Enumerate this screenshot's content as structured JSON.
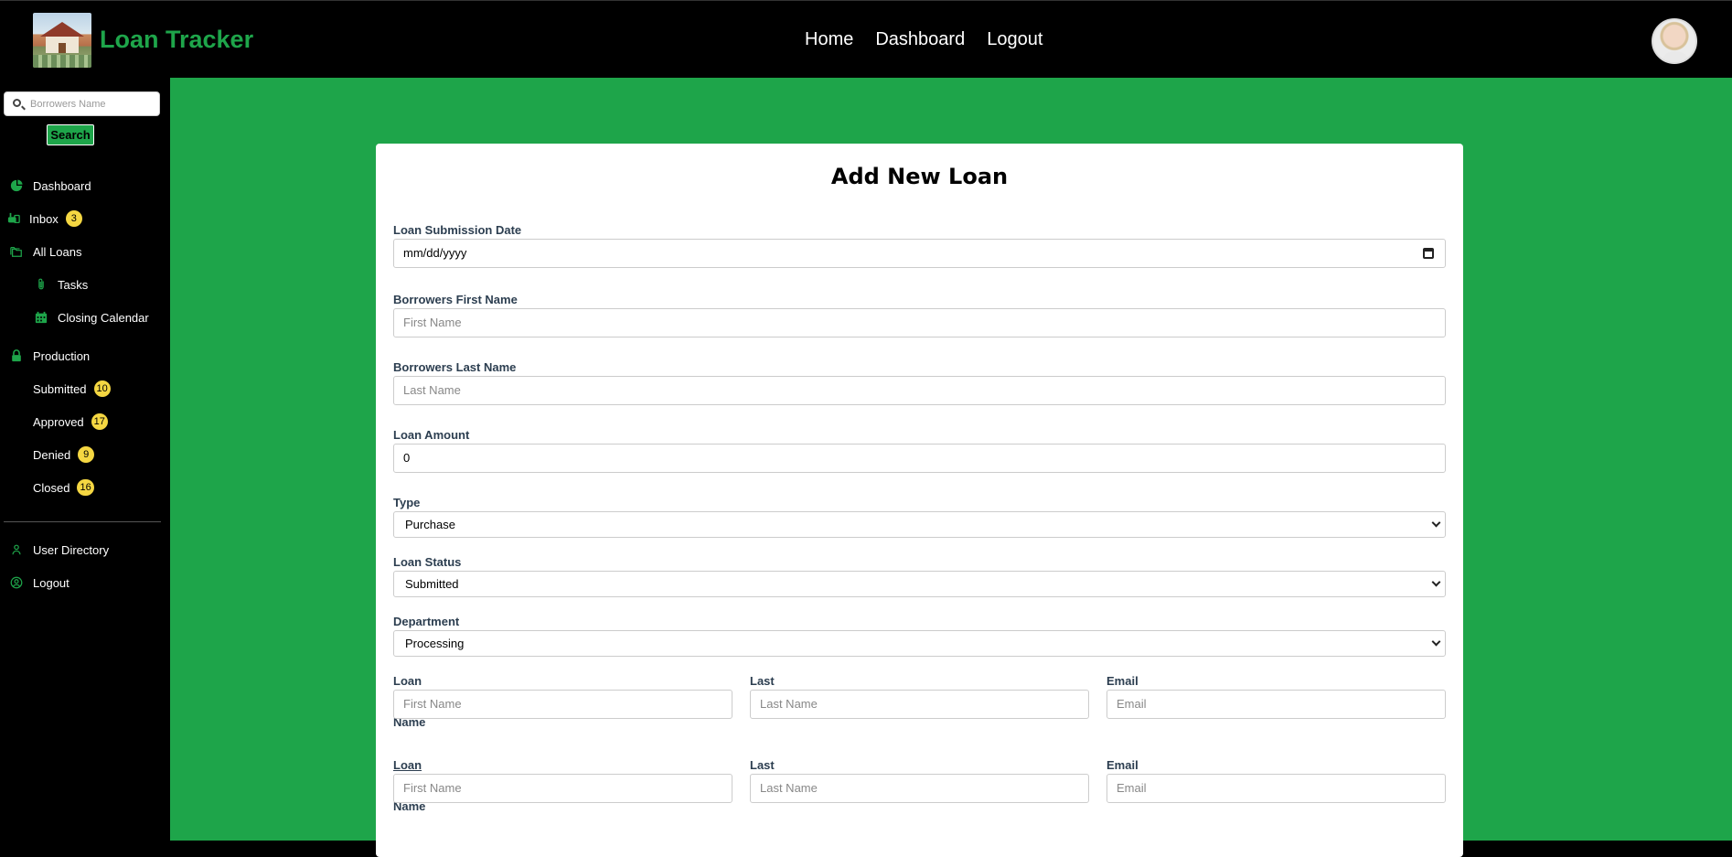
{
  "header": {
    "brand": "Loan Tracker",
    "nav": [
      "Home",
      "Dashboard",
      "Logout"
    ]
  },
  "sidebar": {
    "search_placeholder": "Borrowers Name",
    "search_button": "Search",
    "items": [
      {
        "label": "Dashboard",
        "icon": "pie-chart-icon"
      },
      {
        "label": "Inbox",
        "icon": "mailbox-icon",
        "badge": "3"
      },
      {
        "label": "All Loans",
        "icon": "folders-icon"
      },
      {
        "label": "Tasks",
        "icon": "paperclip-icon"
      },
      {
        "label": "Closing Calendar",
        "icon": "calendar-icon"
      },
      {
        "label": "Production",
        "icon": "lock-icon"
      },
      {
        "label": "Submitted",
        "badge": "10"
      },
      {
        "label": "Approved",
        "badge": "17"
      },
      {
        "label": "Denied",
        "badge": "9"
      },
      {
        "label": "Closed",
        "badge": "16"
      },
      {
        "label": "User Directory",
        "icon": "person-icon"
      },
      {
        "label": "Logout",
        "icon": "user-circle-icon"
      }
    ]
  },
  "form": {
    "title": "Add New Loan",
    "submission_date": {
      "label": "Loan Submission Date",
      "value": "mm/dd/yyyy"
    },
    "first_name": {
      "label": "Borrowers First Name",
      "placeholder": "First Name"
    },
    "last_name": {
      "label": "Borrowers Last Name",
      "placeholder": "Last Name"
    },
    "amount": {
      "label": "Loan Amount",
      "value": "0"
    },
    "type": {
      "label": "Type",
      "value": "Purchase"
    },
    "status": {
      "label": "Loan Status",
      "value": "Submitted"
    },
    "department": {
      "label": "Department",
      "value": "Processing"
    },
    "manager": {
      "label_prefix": "Loan Manager:",
      "first_label": "First Name",
      "last_label": "Last Name",
      "email_label": "Email",
      "first_placeholder": "First Name",
      "last_placeholder": "Last Name",
      "email_placeholder": "Email"
    },
    "officer": {
      "label_prefix": "Loan Officer:",
      "first_label": "First Name",
      "last_label": "Last Name",
      "email_label": "Email",
      "first_placeholder": "First Name",
      "last_placeholder": "Last Name",
      "email_placeholder": "Email"
    }
  },
  "colors": {
    "accent": "#1ea54a",
    "badge": "#f5d742"
  }
}
